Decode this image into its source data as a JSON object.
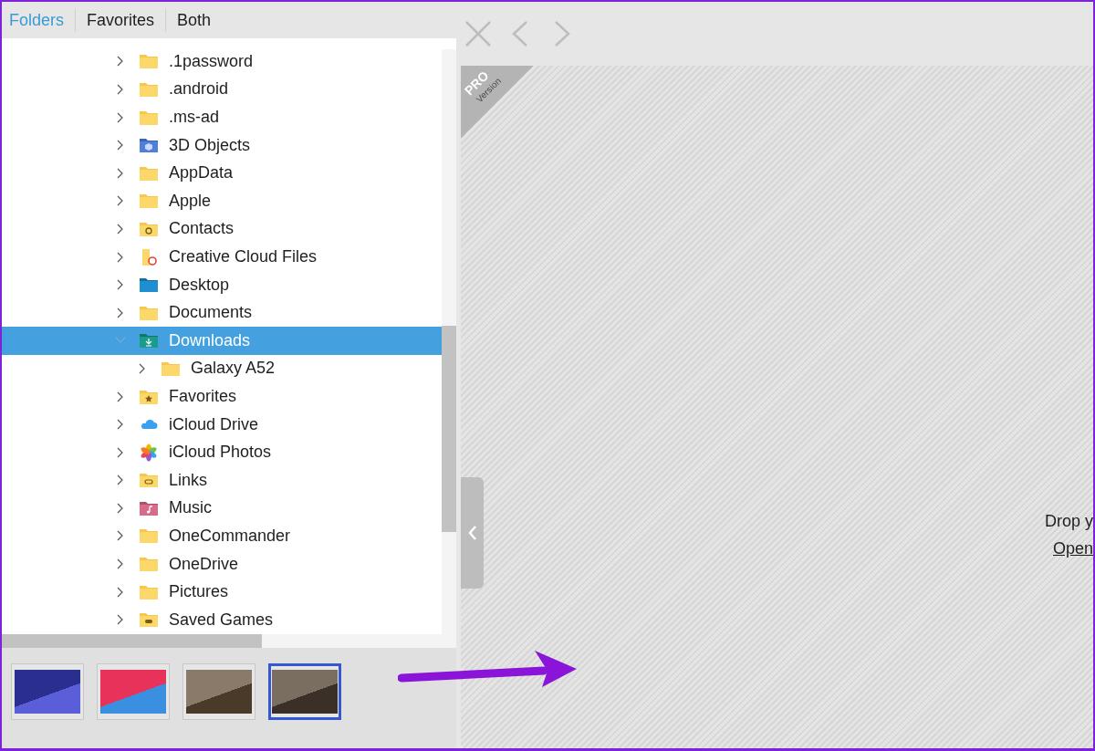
{
  "tabs": [
    {
      "label": "Folders",
      "selected": true
    },
    {
      "label": "Favorites",
      "selected": false
    },
    {
      "label": "Both",
      "selected": false
    }
  ],
  "tree": [
    {
      "label": ".1password",
      "kind": "folder",
      "expanded": false,
      "selected": false
    },
    {
      "label": ".android",
      "kind": "folder",
      "expanded": false,
      "selected": false
    },
    {
      "label": ".ms-ad",
      "kind": "folder",
      "expanded": false,
      "selected": false
    },
    {
      "label": "3D Objects",
      "kind": "objects",
      "expanded": false,
      "selected": false
    },
    {
      "label": "AppData",
      "kind": "folder",
      "expanded": false,
      "selected": false
    },
    {
      "label": "Apple",
      "kind": "folder",
      "expanded": false,
      "selected": false
    },
    {
      "label": "Contacts",
      "kind": "contacts",
      "expanded": false,
      "selected": false
    },
    {
      "label": "Creative Cloud Files",
      "kind": "cloudfiles",
      "expanded": false,
      "selected": false
    },
    {
      "label": "Desktop",
      "kind": "desktop",
      "expanded": false,
      "selected": false
    },
    {
      "label": "Documents",
      "kind": "folder",
      "expanded": false,
      "selected": false
    },
    {
      "label": "Downloads",
      "kind": "downloads",
      "expanded": true,
      "selected": true,
      "children": [
        {
          "label": "Galaxy A52",
          "kind": "folder",
          "expanded": false,
          "selected": false
        }
      ]
    },
    {
      "label": "Favorites",
      "kind": "star",
      "expanded": false,
      "selected": false
    },
    {
      "label": "iCloud Drive",
      "kind": "cloud",
      "expanded": false,
      "selected": false
    },
    {
      "label": "iCloud Photos",
      "kind": "photos",
      "expanded": false,
      "selected": false
    },
    {
      "label": "Links",
      "kind": "links",
      "expanded": false,
      "selected": false
    },
    {
      "label": "Music",
      "kind": "music",
      "expanded": false,
      "selected": false
    },
    {
      "label": "OneCommander",
      "kind": "folder",
      "expanded": false,
      "selected": false
    },
    {
      "label": "OneDrive",
      "kind": "folder",
      "expanded": false,
      "selected": false
    },
    {
      "label": "Pictures",
      "kind": "folder",
      "expanded": false,
      "selected": false
    },
    {
      "label": "Saved Games",
      "kind": "games",
      "expanded": false,
      "selected": false
    }
  ],
  "thumbnails": [
    {
      "selected": false
    },
    {
      "selected": false
    },
    {
      "selected": false
    },
    {
      "selected": true
    }
  ],
  "pro_badge": {
    "title": "PRO",
    "subtitle": "Version"
  },
  "drop_area": {
    "text": "Drop y",
    "link": "Open"
  }
}
